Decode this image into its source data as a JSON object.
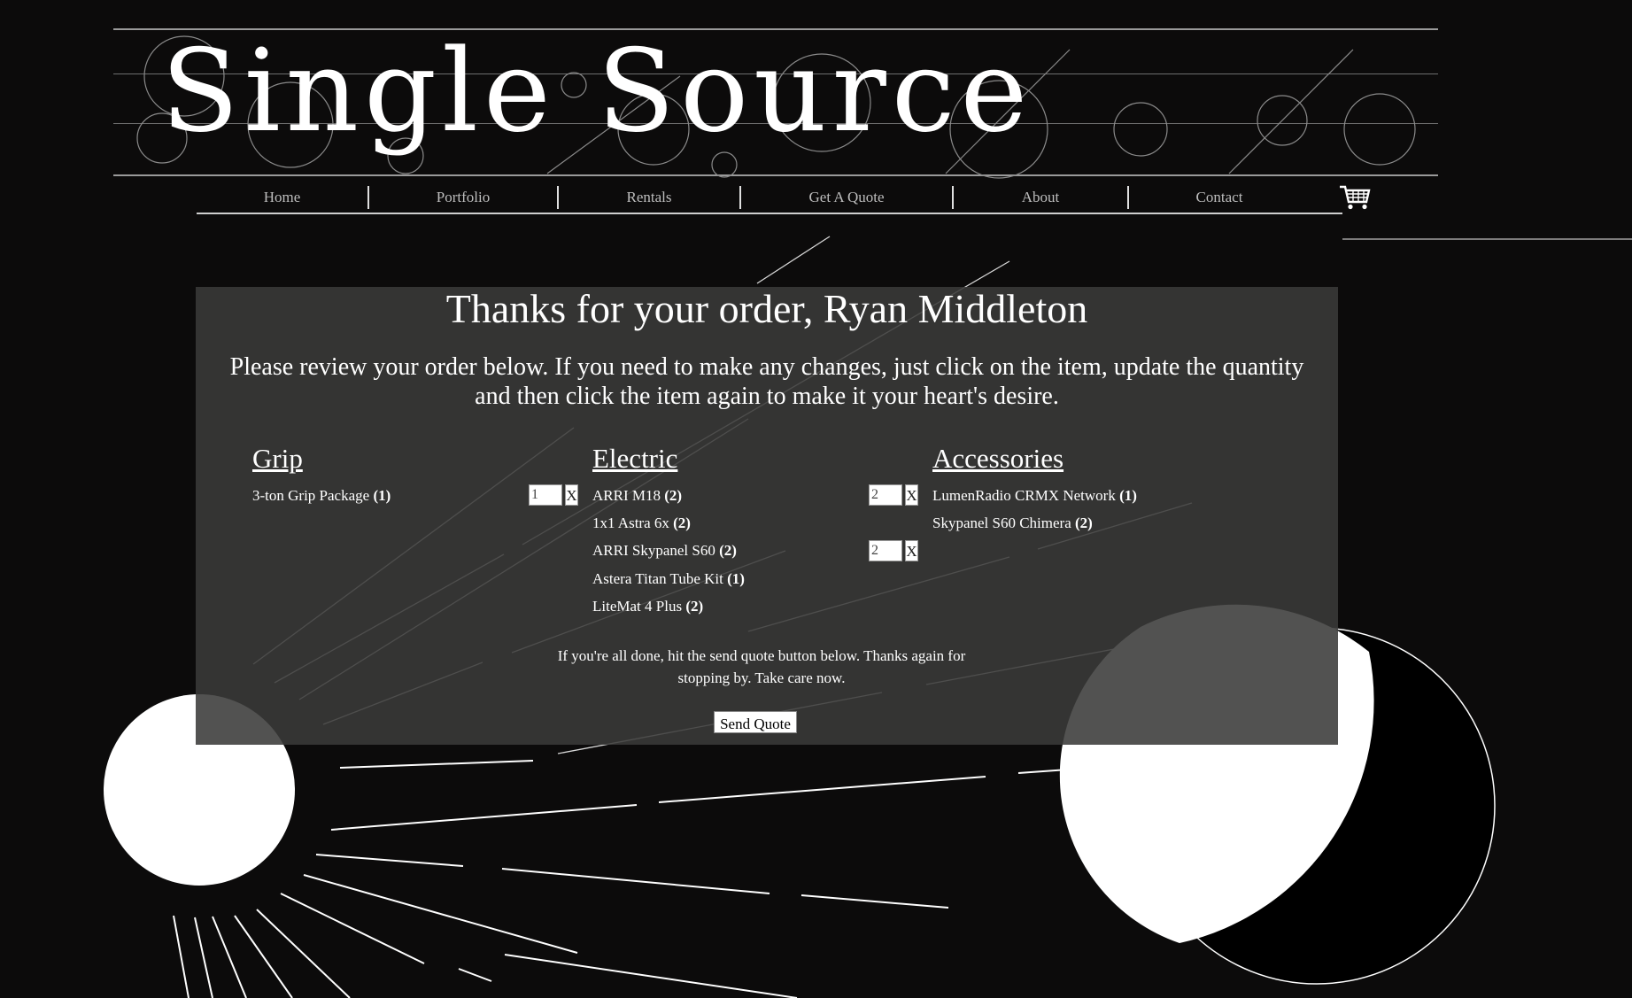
{
  "logo": {
    "text": "Single Source"
  },
  "nav": {
    "items": [
      {
        "label": "Home"
      },
      {
        "label": "Portfolio"
      },
      {
        "label": "Rentals"
      },
      {
        "label": "Get A Quote"
      },
      {
        "label": "About"
      },
      {
        "label": "Contact"
      }
    ],
    "cart_icon": "shopping-cart-icon"
  },
  "order": {
    "title": "Thanks for your order, Ryan Middleton",
    "intro": "Please review your order below. If you need to make any changes, just click on the item, update the quantity and then click the item again to make it your heart's desire.",
    "columns": [
      {
        "heading": "Grip",
        "items": [
          {
            "name": "3-ton Grip Package",
            "qty": "(1)",
            "edit_value": "1",
            "remove": "X"
          }
        ]
      },
      {
        "heading": "Electric",
        "items": [
          {
            "name": "ARRI M18",
            "qty": "(2)",
            "edit_value": "2",
            "remove": "X"
          },
          {
            "name": "1x1 Astra 6x",
            "qty": "(2)"
          },
          {
            "name": "ARRI Skypanel S60",
            "qty": "(2)",
            "edit_value": "2",
            "remove": "X"
          },
          {
            "name": "Astera Titan Tube Kit",
            "qty": "(1)"
          },
          {
            "name": "LiteMat 4 Plus",
            "qty": "(2)"
          }
        ]
      },
      {
        "heading": "Accessories",
        "items": [
          {
            "name": "LumenRadio CRMX Network",
            "qty": "(1)"
          },
          {
            "name": "Skypanel S60 Chimera",
            "qty": "(2)"
          }
        ]
      }
    ],
    "done_text": "If you're all done, hit the send quote button below. Thanks again for stopping by. Take care now.",
    "send_label": "Send Quote"
  },
  "colors": {
    "background": "#0c0b0b",
    "panel": "#3a3a39",
    "text": "#ffffff",
    "nav_text": "#bdbdbd"
  }
}
